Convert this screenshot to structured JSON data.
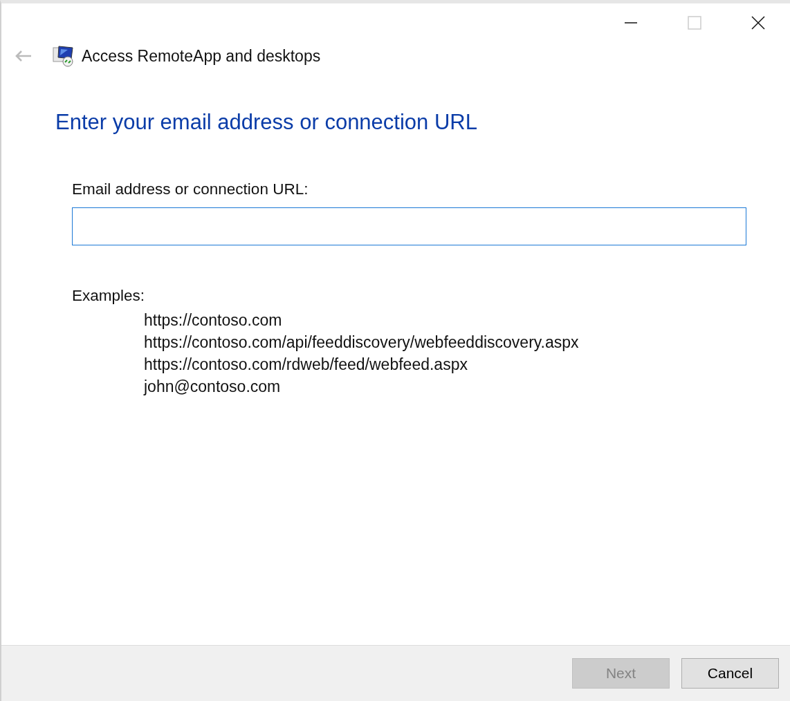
{
  "window": {
    "title": "Access RemoteApp and desktops"
  },
  "heading": "Enter your email address or connection URL",
  "field": {
    "label": "Email address or connection URL:"
  },
  "examples": {
    "label": "Examples:",
    "items": [
      "https://contoso.com",
      "https://contoso.com/api/feeddiscovery/webfeeddiscovery.aspx",
      "https://contoso.com/rdweb/feed/webfeed.aspx",
      "john@contoso.com"
    ]
  },
  "buttons": [
    {
      "label": "Next",
      "disabled": true
    },
    {
      "label": "Cancel",
      "disabled": false
    }
  ]
}
